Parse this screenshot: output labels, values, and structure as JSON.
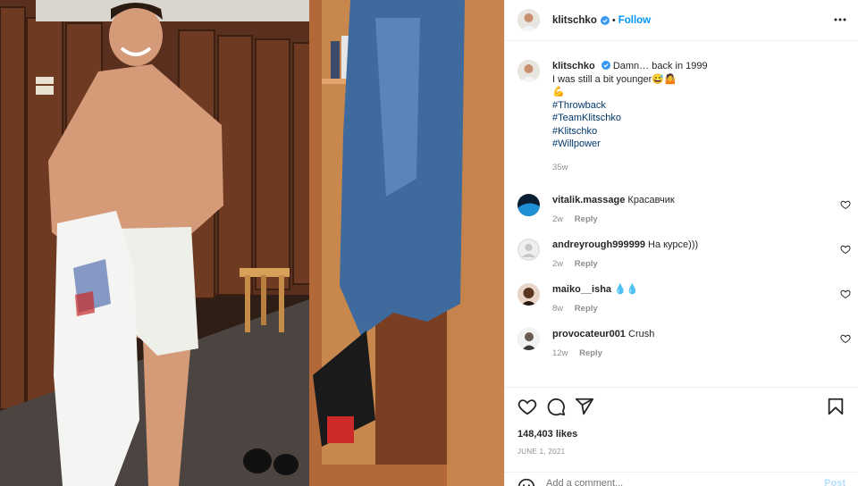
{
  "post": {
    "author": "klitschko",
    "follow_label": "Follow",
    "dot": "•",
    "caption": {
      "author": "klitschko",
      "text": "Damn… back in 1999\nI was still a bit younger😅🤷",
      "flex_emoji": "💪",
      "hashtags": [
        "#Throwback",
        "#TeamKlitschko",
        "#Klitschko",
        "#Willpower"
      ],
      "age": "35w"
    },
    "comments": [
      {
        "user": "vitalik.massage",
        "text": "Красавчик",
        "age": "2w",
        "reply": "Reply"
      },
      {
        "user": "andreyrough999999",
        "text": "На курсе)))",
        "age": "2w",
        "reply": "Reply"
      },
      {
        "user": "maiko__isha",
        "text": "💧💧",
        "age": "8w",
        "reply": "Reply"
      },
      {
        "user": "provocateur001",
        "text": "Crush",
        "age": "12w",
        "reply": "Reply"
      }
    ],
    "likes": "148,403 likes",
    "date": "JUNE 1, 2021",
    "add_comment_placeholder": "Add a comment...",
    "post_label": "Post"
  },
  "icons": {
    "verified": "verified-badge-icon",
    "more": "more-options-icon",
    "like": "heart-icon",
    "comment": "comment-bubble-icon",
    "share": "paper-plane-icon",
    "save": "bookmark-icon",
    "emoji": "smiley-icon"
  },
  "colors": {
    "accent": "#0095f6",
    "hashtag": "#00376b",
    "muted": "#8e8e8e",
    "text": "#262626"
  }
}
